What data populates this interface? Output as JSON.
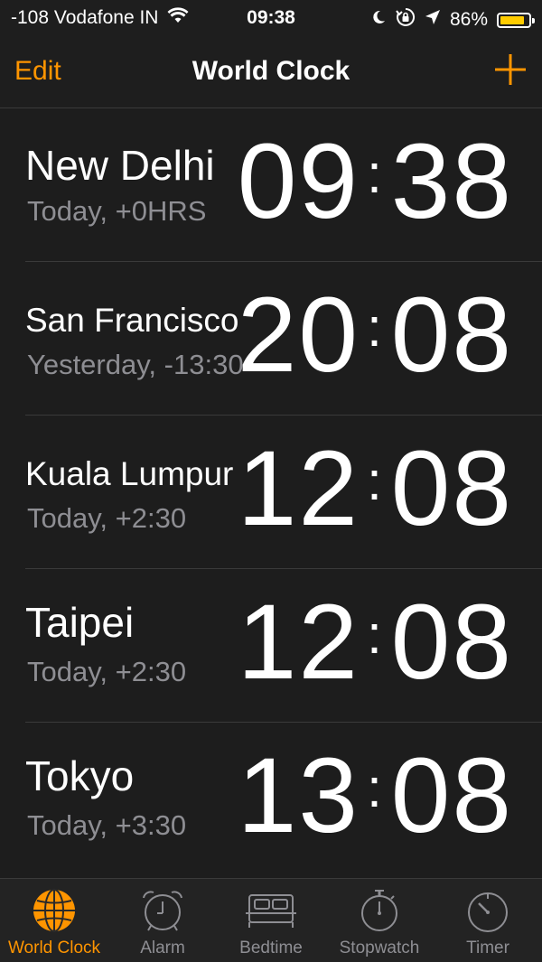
{
  "status_bar": {
    "carrier": "-108 Vodafone IN",
    "time": "09:38",
    "battery_percent_label": "86%",
    "battery_level": 0.86,
    "battery_color": "#ffcc00",
    "icons": [
      "wifi-icon",
      "moon-icon",
      "rotation-lock-icon",
      "location-arrow-icon",
      "battery-icon"
    ]
  },
  "nav": {
    "edit_label": "Edit",
    "title": "World Clock",
    "add_icon": "plus-icon"
  },
  "clocks": [
    {
      "city": "New Delhi",
      "offset": "Today, +0HRS",
      "hour": "09",
      "minute": "38"
    },
    {
      "city": "San Francisco",
      "offset": "Yesterday, -13:30",
      "hour": "20",
      "minute": "08"
    },
    {
      "city": "Kuala Lumpur",
      "offset": "Today, +2:30",
      "hour": "12",
      "minute": "08"
    },
    {
      "city": "Taipei",
      "offset": "Today, +2:30",
      "hour": "12",
      "minute": "08"
    },
    {
      "city": "Tokyo",
      "offset": "Today, +3:30",
      "hour": "13",
      "minute": "08"
    }
  ],
  "tabs": [
    {
      "label": "World Clock",
      "icon": "globe-icon",
      "active": true
    },
    {
      "label": "Alarm",
      "icon": "alarm-clock-icon",
      "active": false
    },
    {
      "label": "Bedtime",
      "icon": "bed-icon",
      "active": false
    },
    {
      "label": "Stopwatch",
      "icon": "stopwatch-icon",
      "active": false
    },
    {
      "label": "Timer",
      "icon": "timer-icon",
      "active": false
    }
  ],
  "colors": {
    "accent": "#ff9500",
    "background": "#1d1d1d",
    "secondary_text": "#8e8e93"
  }
}
